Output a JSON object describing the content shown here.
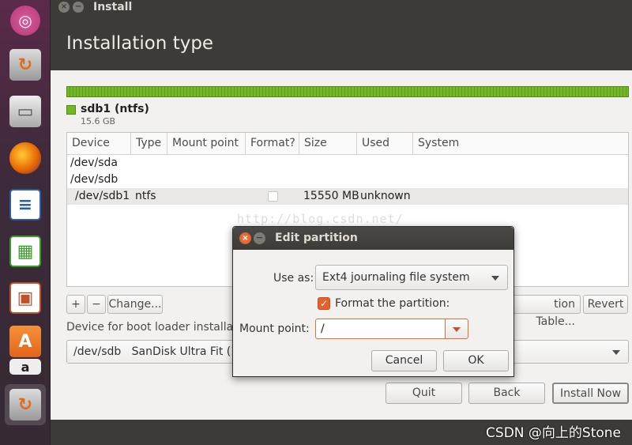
{
  "window": {
    "title": "Install",
    "heading": "Installation type"
  },
  "launcher": {
    "items": [
      "ubuntu-logo-icon",
      "installer-icon",
      "files-icon",
      "firefox-icon",
      "writer-icon",
      "calc-icon",
      "impress-icon",
      "software-center-icon",
      "amazon-icon",
      "installer-active-icon"
    ]
  },
  "partition_bar": {
    "name": "sdb1 (ntfs)",
    "size": "15.6 GB",
    "color": "#73b927"
  },
  "table": {
    "headers": [
      "Device",
      "Type",
      "Mount point",
      "Format?",
      "Size",
      "Used",
      "System"
    ],
    "rows": [
      {
        "device": "/dev/sda"
      },
      {
        "device": "/dev/sdb"
      },
      {
        "device": "/dev/sdb1",
        "type": "ntfs",
        "size": "15550 MB",
        "used": "unknown"
      }
    ]
  },
  "partition_buttons": {
    "add": "+",
    "remove": "−",
    "change": "Change...",
    "new_table_partial": "tion Table...",
    "revert": "Revert"
  },
  "bootloader": {
    "label_partial": "Device for boot loader installat",
    "value_partial": "/dev/sdb   SanDisk Ultra Fit (1"
  },
  "nav_buttons": {
    "quit": "Quit",
    "back": "Back",
    "install_now": "Install Now"
  },
  "watermark_url": "http://blog.csdn.net/",
  "watermark_credit": "CSDN @向上的Stone",
  "dialog": {
    "title": "Edit partition",
    "use_as_label": "Use as:",
    "use_as_value": "Ext4 journaling file system",
    "format_label": "Format the partition:",
    "format_checked": true,
    "mount_label": "Mount point:",
    "mount_value": "/",
    "cancel": "Cancel",
    "ok": "OK"
  }
}
